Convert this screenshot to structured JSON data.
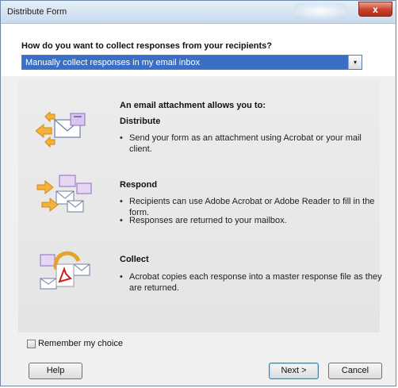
{
  "window": {
    "title": "Distribute Form",
    "close_glyph": "x"
  },
  "question": "How do you want to collect responses from your recipients?",
  "method_select": {
    "value": "Manually collect responses in my email inbox",
    "arrow_glyph": "▾"
  },
  "info": {
    "heading": "An email attachment allows you to:",
    "sections": [
      {
        "title": "Distribute",
        "icon": "email-attachment-icon",
        "bullets": [
          "Send your form as an attachment using Acrobat or your mail client."
        ]
      },
      {
        "title": "Respond",
        "icon": "email-respond-icon",
        "bullets": [
          "Recipients can use Adobe Acrobat or Adobe Reader to fill in the form.",
          "Responses are returned to your mailbox."
        ]
      },
      {
        "title": "Collect",
        "icon": "acrobat-collect-icon",
        "bullets": [
          "Acrobat copies each response into a master response file as they are returned."
        ]
      }
    ],
    "bullet_glyph": "•"
  },
  "remember_choice": {
    "label": "Remember my choice",
    "checked": false
  },
  "buttons": {
    "help": "Help",
    "next": "Next >",
    "cancel": "Cancel"
  },
  "colors": {
    "select_highlight": "#3a6fc4",
    "close_button": "#c7412b",
    "content_bg": "#e6e6e6"
  }
}
